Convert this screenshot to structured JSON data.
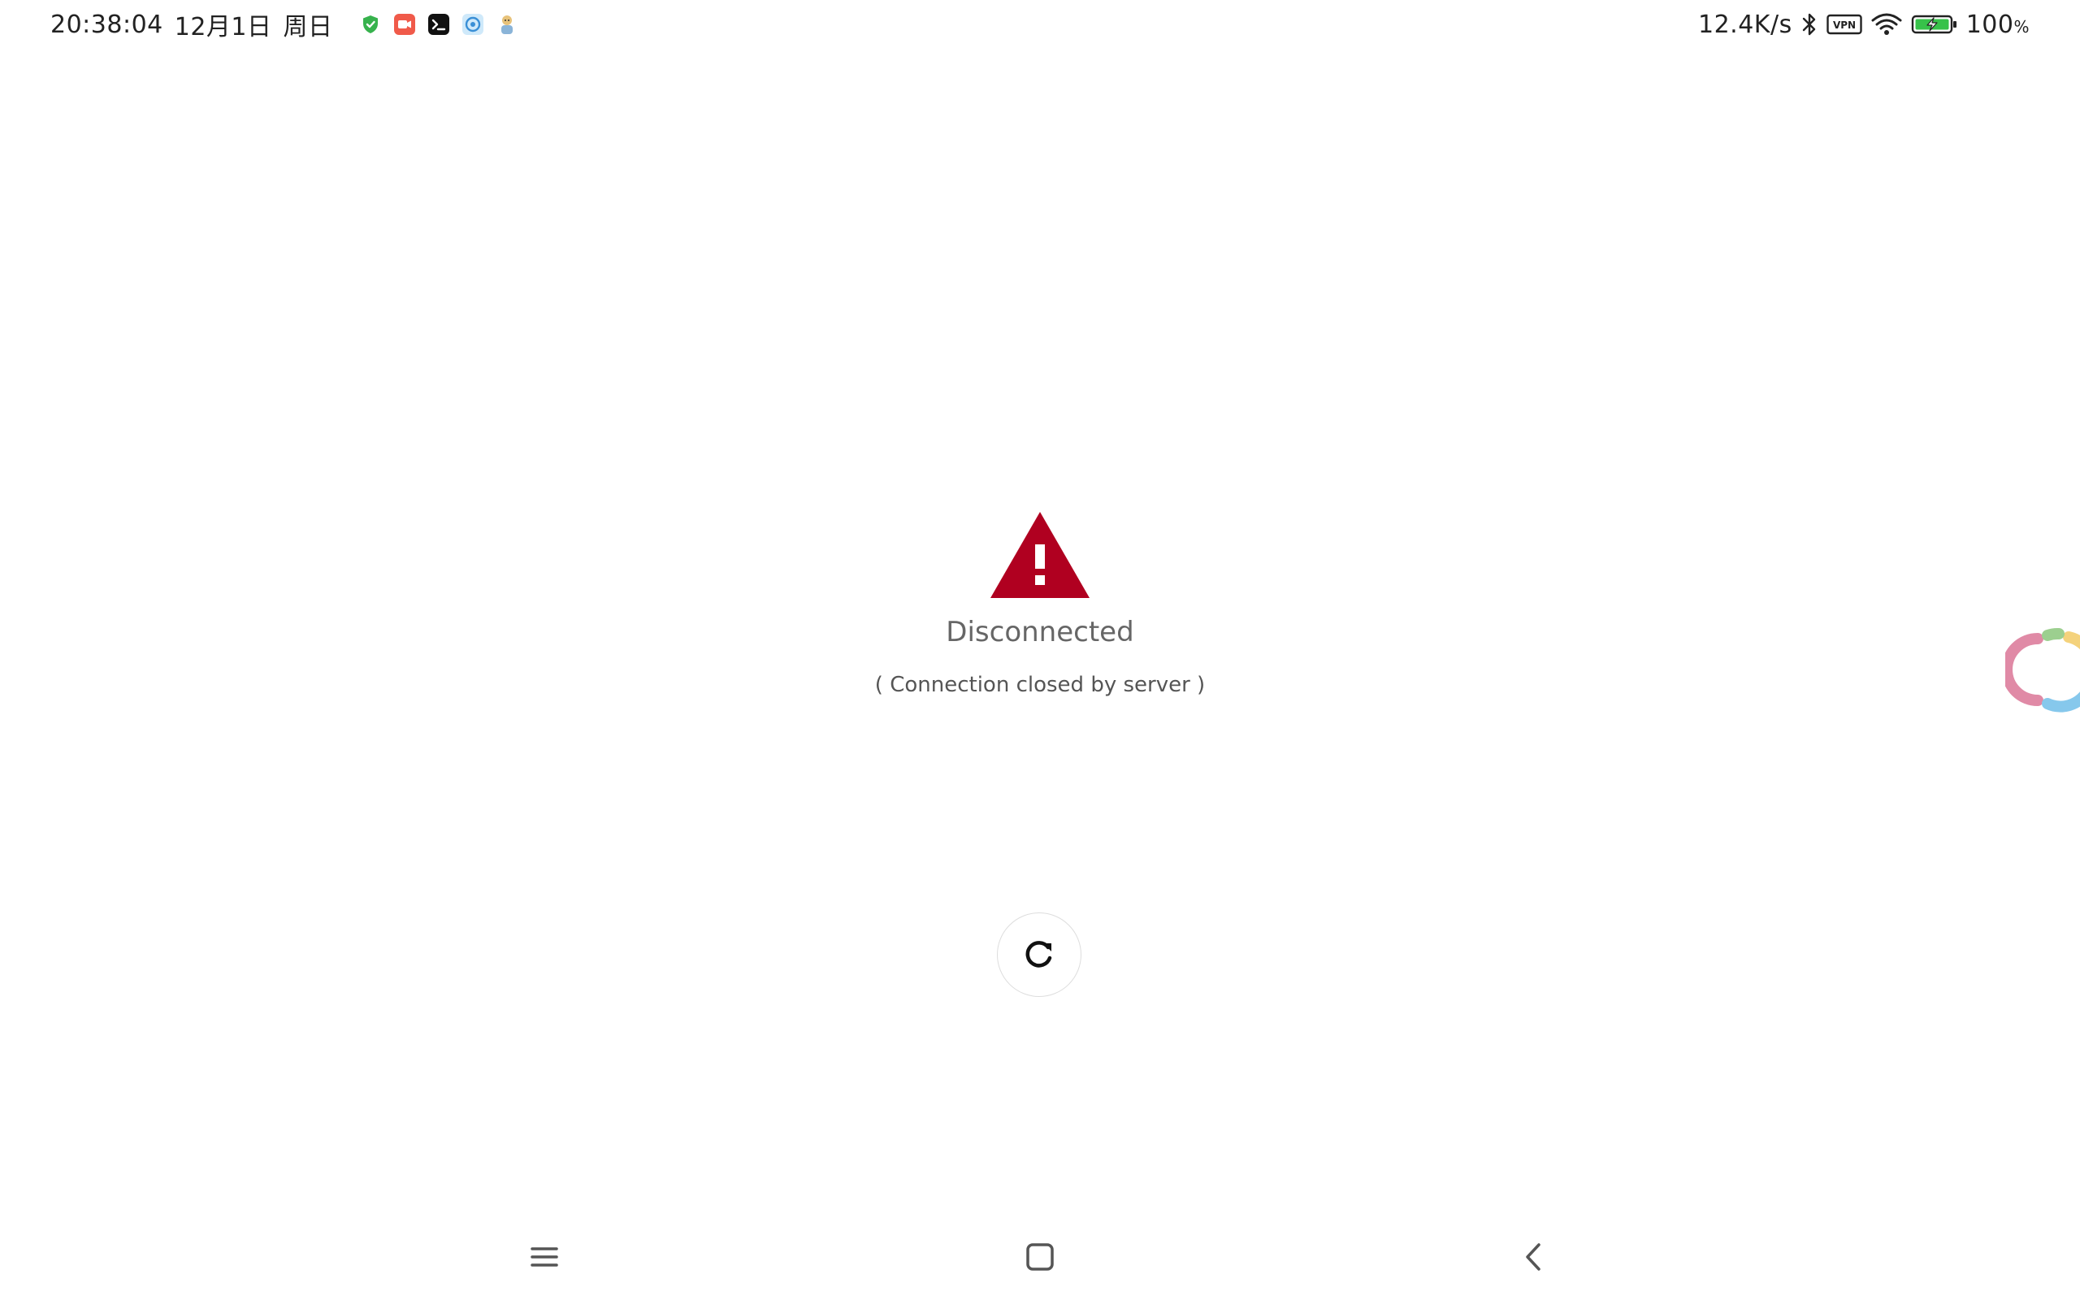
{
  "status_bar": {
    "time": "20:38:04",
    "date": "12月1日",
    "weekday": "周日",
    "net_speed": "12.4K/s",
    "battery": "100",
    "battery_unit": "%",
    "icons_left": [
      "shield-icon",
      "video-record-icon",
      "terminal-icon",
      "browser-app-icon",
      "character-app-icon"
    ],
    "icons_right": [
      "bluetooth-icon",
      "vpn-icon",
      "wifi-icon",
      "battery-charging-icon"
    ]
  },
  "main": {
    "title": "Disconnected",
    "subtitle": "( Connection closed by server )",
    "warning_icon": "warning-triangle-icon",
    "reload_icon": "reload-icon",
    "warning_color": "#b00020"
  },
  "side_widget": {
    "icon": "floating-ball-icon",
    "colors": [
      "#e08aa6",
      "#86c8ec",
      "#f4d27c",
      "#9ccf8f"
    ]
  },
  "nav_bar": {
    "items": [
      "menu-icon",
      "home-icon",
      "back-icon"
    ]
  }
}
